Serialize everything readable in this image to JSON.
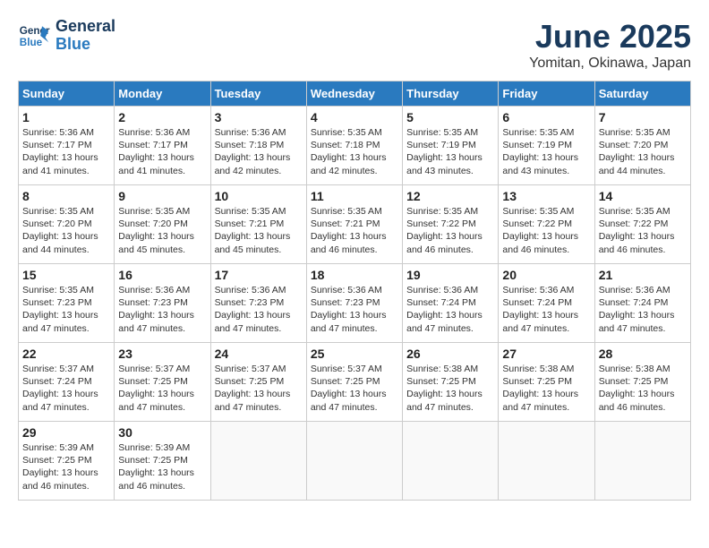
{
  "header": {
    "logo_line1": "General",
    "logo_line2": "Blue",
    "title": "June 2025",
    "subtitle": "Yomitan, Okinawa, Japan"
  },
  "columns": [
    "Sunday",
    "Monday",
    "Tuesday",
    "Wednesday",
    "Thursday",
    "Friday",
    "Saturday"
  ],
  "weeks": [
    [
      {
        "day": "1",
        "sunrise": "Sunrise: 5:36 AM",
        "sunset": "Sunset: 7:17 PM",
        "daylight": "Daylight: 13 hours and 41 minutes."
      },
      {
        "day": "2",
        "sunrise": "Sunrise: 5:36 AM",
        "sunset": "Sunset: 7:17 PM",
        "daylight": "Daylight: 13 hours and 41 minutes."
      },
      {
        "day": "3",
        "sunrise": "Sunrise: 5:36 AM",
        "sunset": "Sunset: 7:18 PM",
        "daylight": "Daylight: 13 hours and 42 minutes."
      },
      {
        "day": "4",
        "sunrise": "Sunrise: 5:35 AM",
        "sunset": "Sunset: 7:18 PM",
        "daylight": "Daylight: 13 hours and 42 minutes."
      },
      {
        "day": "5",
        "sunrise": "Sunrise: 5:35 AM",
        "sunset": "Sunset: 7:19 PM",
        "daylight": "Daylight: 13 hours and 43 minutes."
      },
      {
        "day": "6",
        "sunrise": "Sunrise: 5:35 AM",
        "sunset": "Sunset: 7:19 PM",
        "daylight": "Daylight: 13 hours and 43 minutes."
      },
      {
        "day": "7",
        "sunrise": "Sunrise: 5:35 AM",
        "sunset": "Sunset: 7:20 PM",
        "daylight": "Daylight: 13 hours and 44 minutes."
      }
    ],
    [
      {
        "day": "8",
        "sunrise": "Sunrise: 5:35 AM",
        "sunset": "Sunset: 7:20 PM",
        "daylight": "Daylight: 13 hours and 44 minutes."
      },
      {
        "day": "9",
        "sunrise": "Sunrise: 5:35 AM",
        "sunset": "Sunset: 7:20 PM",
        "daylight": "Daylight: 13 hours and 45 minutes."
      },
      {
        "day": "10",
        "sunrise": "Sunrise: 5:35 AM",
        "sunset": "Sunset: 7:21 PM",
        "daylight": "Daylight: 13 hours and 45 minutes."
      },
      {
        "day": "11",
        "sunrise": "Sunrise: 5:35 AM",
        "sunset": "Sunset: 7:21 PM",
        "daylight": "Daylight: 13 hours and 46 minutes."
      },
      {
        "day": "12",
        "sunrise": "Sunrise: 5:35 AM",
        "sunset": "Sunset: 7:22 PM",
        "daylight": "Daylight: 13 hours and 46 minutes."
      },
      {
        "day": "13",
        "sunrise": "Sunrise: 5:35 AM",
        "sunset": "Sunset: 7:22 PM",
        "daylight": "Daylight: 13 hours and 46 minutes."
      },
      {
        "day": "14",
        "sunrise": "Sunrise: 5:35 AM",
        "sunset": "Sunset: 7:22 PM",
        "daylight": "Daylight: 13 hours and 46 minutes."
      }
    ],
    [
      {
        "day": "15",
        "sunrise": "Sunrise: 5:35 AM",
        "sunset": "Sunset: 7:23 PM",
        "daylight": "Daylight: 13 hours and 47 minutes."
      },
      {
        "day": "16",
        "sunrise": "Sunrise: 5:36 AM",
        "sunset": "Sunset: 7:23 PM",
        "daylight": "Daylight: 13 hours and 47 minutes."
      },
      {
        "day": "17",
        "sunrise": "Sunrise: 5:36 AM",
        "sunset": "Sunset: 7:23 PM",
        "daylight": "Daylight: 13 hours and 47 minutes."
      },
      {
        "day": "18",
        "sunrise": "Sunrise: 5:36 AM",
        "sunset": "Sunset: 7:23 PM",
        "daylight": "Daylight: 13 hours and 47 minutes."
      },
      {
        "day": "19",
        "sunrise": "Sunrise: 5:36 AM",
        "sunset": "Sunset: 7:24 PM",
        "daylight": "Daylight: 13 hours and 47 minutes."
      },
      {
        "day": "20",
        "sunrise": "Sunrise: 5:36 AM",
        "sunset": "Sunset: 7:24 PM",
        "daylight": "Daylight: 13 hours and 47 minutes."
      },
      {
        "day": "21",
        "sunrise": "Sunrise: 5:36 AM",
        "sunset": "Sunset: 7:24 PM",
        "daylight": "Daylight: 13 hours and 47 minutes."
      }
    ],
    [
      {
        "day": "22",
        "sunrise": "Sunrise: 5:37 AM",
        "sunset": "Sunset: 7:24 PM",
        "daylight": "Daylight: 13 hours and 47 minutes."
      },
      {
        "day": "23",
        "sunrise": "Sunrise: 5:37 AM",
        "sunset": "Sunset: 7:25 PM",
        "daylight": "Daylight: 13 hours and 47 minutes."
      },
      {
        "day": "24",
        "sunrise": "Sunrise: 5:37 AM",
        "sunset": "Sunset: 7:25 PM",
        "daylight": "Daylight: 13 hours and 47 minutes."
      },
      {
        "day": "25",
        "sunrise": "Sunrise: 5:37 AM",
        "sunset": "Sunset: 7:25 PM",
        "daylight": "Daylight: 13 hours and 47 minutes."
      },
      {
        "day": "26",
        "sunrise": "Sunrise: 5:38 AM",
        "sunset": "Sunset: 7:25 PM",
        "daylight": "Daylight: 13 hours and 47 minutes."
      },
      {
        "day": "27",
        "sunrise": "Sunrise: 5:38 AM",
        "sunset": "Sunset: 7:25 PM",
        "daylight": "Daylight: 13 hours and 47 minutes."
      },
      {
        "day": "28",
        "sunrise": "Sunrise: 5:38 AM",
        "sunset": "Sunset: 7:25 PM",
        "daylight": "Daylight: 13 hours and 46 minutes."
      }
    ],
    [
      {
        "day": "29",
        "sunrise": "Sunrise: 5:39 AM",
        "sunset": "Sunset: 7:25 PM",
        "daylight": "Daylight: 13 hours and 46 minutes."
      },
      {
        "day": "30",
        "sunrise": "Sunrise: 5:39 AM",
        "sunset": "Sunset: 7:25 PM",
        "daylight": "Daylight: 13 hours and 46 minutes."
      },
      null,
      null,
      null,
      null,
      null
    ]
  ]
}
